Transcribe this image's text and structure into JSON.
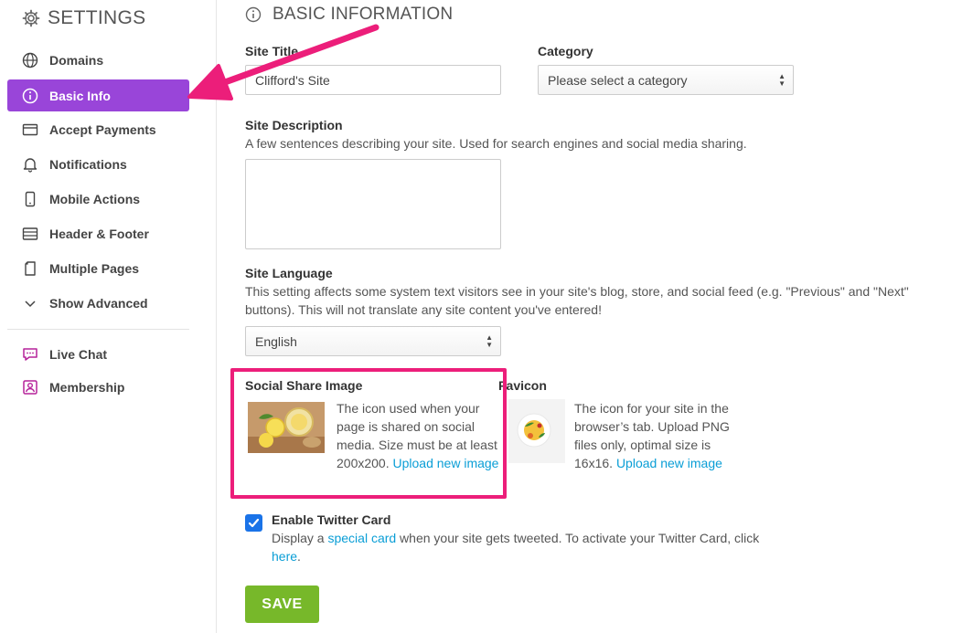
{
  "sidebar": {
    "title": "SETTINGS",
    "items": [
      {
        "label": "Domains",
        "icon": "globe-icon"
      },
      {
        "label": "Basic Info",
        "icon": "info-icon"
      },
      {
        "label": "Accept Payments",
        "icon": "card-icon"
      },
      {
        "label": "Notifications",
        "icon": "bell-icon"
      },
      {
        "label": "Mobile Actions",
        "icon": "phone-icon"
      },
      {
        "label": "Header & Footer",
        "icon": "header-footer-icon"
      },
      {
        "label": "Multiple Pages",
        "icon": "pages-icon"
      },
      {
        "label": "Show Advanced",
        "icon": "chevron-down-icon"
      }
    ],
    "extras": [
      {
        "label": "Live Chat",
        "icon": "chat-icon"
      },
      {
        "label": "Membership",
        "icon": "membership-icon"
      }
    ]
  },
  "main": {
    "title": "BASIC INFORMATION",
    "site_title": {
      "label": "Site Title",
      "value": "Clifford's Site"
    },
    "category": {
      "label": "Category",
      "value": "Please select a category"
    },
    "description": {
      "label": "Site Description",
      "help": "A few sentences describing your site. Used for search engines and social media sharing.",
      "value": ""
    },
    "language": {
      "label": "Site Language",
      "help": "This setting affects some system text visitors see in your site's blog, store, and social feed (e.g. \"Previous\" and \"Next\" buttons). This will not translate any site content you've entered!",
      "value": "English"
    },
    "social_image": {
      "label": "Social Share Image",
      "help": "The icon used when your page is shared on social media. Size must be at least 200x200.",
      "link": "Upload new image"
    },
    "favicon": {
      "label": "Favicon",
      "help": "The icon for your site in the browser’s tab. Upload PNG files only, optimal size is 16x16.",
      "link": "Upload new image"
    },
    "twitter": {
      "label": "Enable Twitter Card",
      "checked": true,
      "text_1": "Display a ",
      "link_1": "special card",
      "text_2": " when your site gets tweeted. To activate your Twitter Card, click ",
      "link_2": "here",
      "text_3": "."
    },
    "save_label": "SAVE"
  },
  "colors": {
    "accent": "#9945d9",
    "annotation": "#ec1e7a",
    "save": "#77b82a",
    "link": "#0a9ed6"
  }
}
